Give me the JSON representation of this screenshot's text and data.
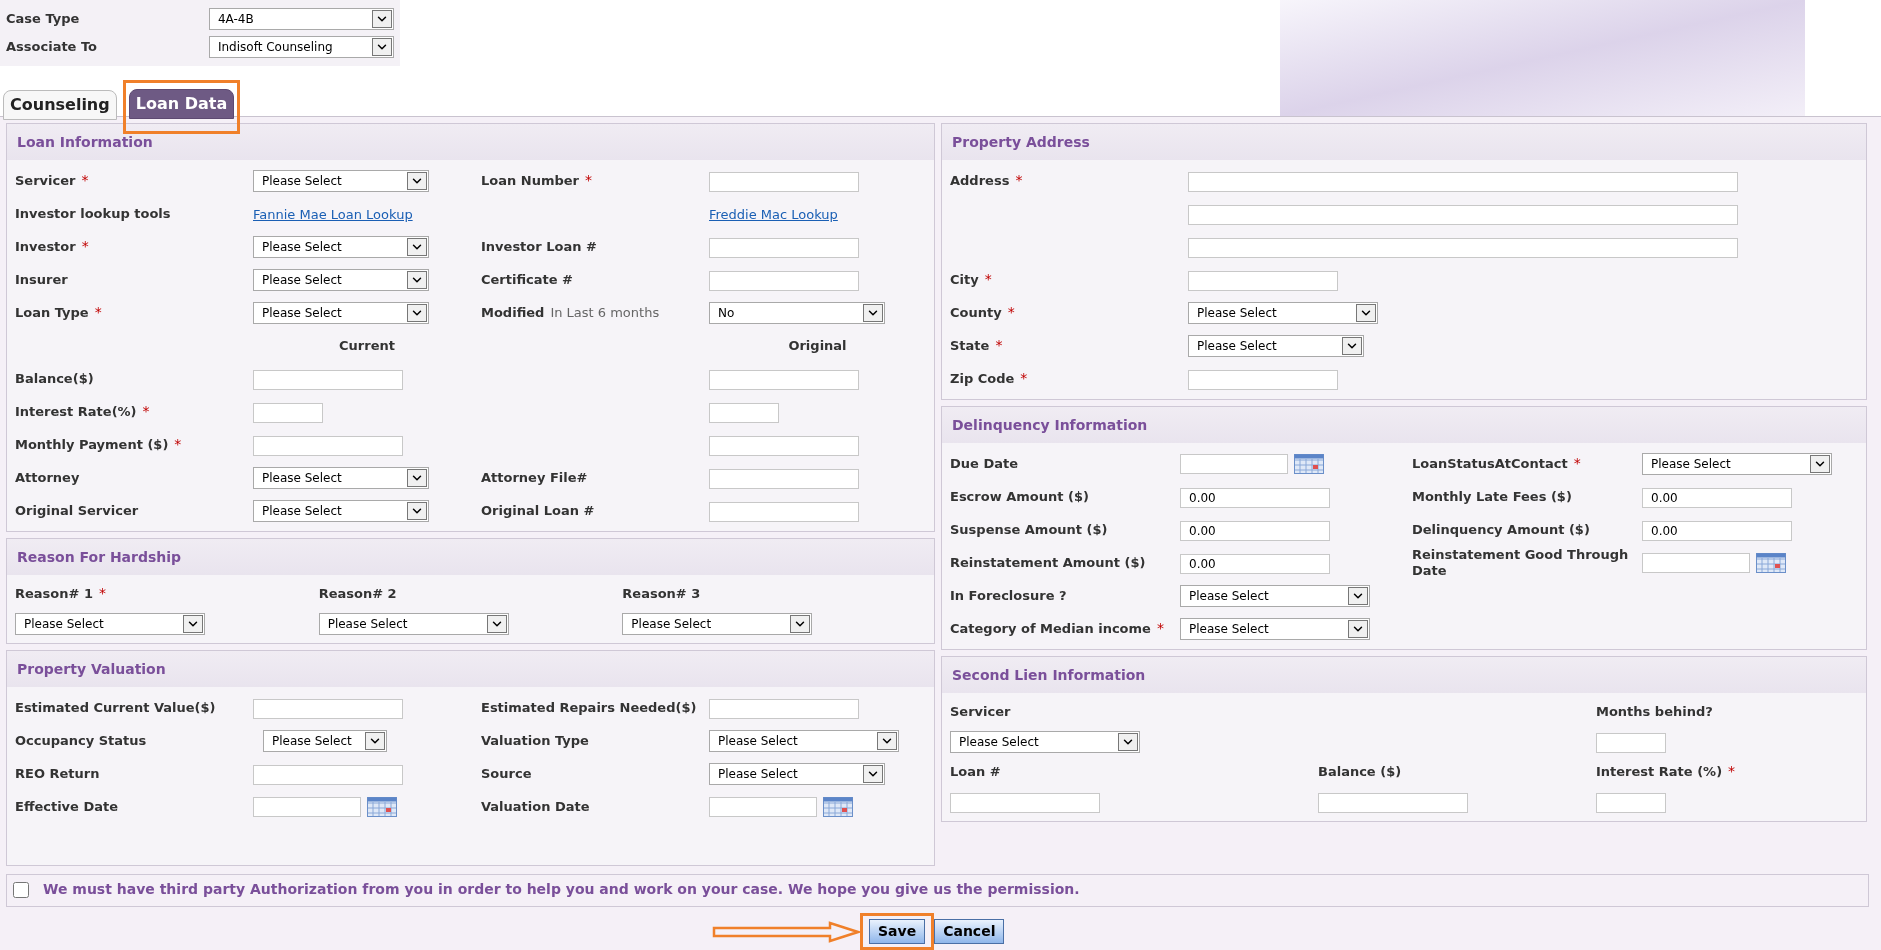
{
  "header": {
    "fields": [
      {
        "label": "Case Type",
        "value": "4A-4B"
      },
      {
        "label": "Associate To",
        "value": "Indisoft Counseling"
      }
    ],
    "tabs": [
      {
        "label": "Counseling",
        "selected": false,
        "highlighted": false
      },
      {
        "label": "Loan Data",
        "selected": true,
        "highlighted": true
      }
    ]
  },
  "left_column": [
    {
      "title": "Loan Information",
      "kind": "four_column",
      "rows": [
        {
          "cells": [
            {
              "kind": "label",
              "text": "Servicer",
              "mark": "*"
            },
            {
              "kind": "select",
              "value": "Please Select"
            },
            {
              "kind": "label",
              "text": "Loan Number",
              "mark": "*"
            },
            {
              "kind": "text"
            }
          ]
        },
        {
          "cells": [
            {
              "kind": "label",
              "text": "Investor lookup tools"
            },
            {
              "kind": "link",
              "text": "Fannie Mae Loan Lookup"
            },
            {
              "kind": "blank"
            },
            {
              "kind": "link",
              "text": "Freddie Mac Lookup"
            }
          ]
        },
        {
          "cells": [
            {
              "kind": "label",
              "text": "Investor",
              "mark": "*"
            },
            {
              "kind": "select",
              "value": "Please Select"
            },
            {
              "kind": "label",
              "text": "Investor Loan #"
            },
            {
              "kind": "text"
            }
          ]
        },
        {
          "cells": [
            {
              "kind": "label",
              "text": "Insurer"
            },
            {
              "kind": "select",
              "value": "Please Select"
            },
            {
              "kind": "label",
              "text": "Certificate #"
            },
            {
              "kind": "text"
            }
          ]
        },
        {
          "cells": [
            {
              "kind": "label",
              "text": "Loan Type",
              "mark": "*"
            },
            {
              "kind": "select",
              "value": "Please Select"
            },
            {
              "kind": "label",
              "text": "Modified",
              "note": "In Last 6 months"
            },
            {
              "kind": "select",
              "value": "No"
            }
          ]
        },
        {
          "cells": [
            {
              "kind": "blank"
            },
            {
              "kind": "heading",
              "text": "Current"
            },
            {
              "kind": "blank"
            },
            {
              "kind": "heading",
              "text": "Original"
            }
          ]
        },
        {
          "cells": [
            {
              "kind": "label",
              "text": "Balance($)"
            },
            {
              "kind": "text"
            },
            {
              "kind": "blank"
            },
            {
              "kind": "text"
            }
          ]
        },
        {
          "cells": [
            {
              "kind": "label",
              "text": "Interest Rate(%)",
              "mark": "*"
            },
            {
              "kind": "short"
            },
            {
              "kind": "blank"
            },
            {
              "kind": "short"
            }
          ]
        },
        {
          "cells": [
            {
              "kind": "label",
              "text": "Monthly Payment ($)",
              "mark": "*"
            },
            {
              "kind": "text"
            },
            {
              "kind": "blank"
            },
            {
              "kind": "text"
            }
          ]
        },
        {
          "cells": [
            {
              "kind": "label",
              "text": "Attorney"
            },
            {
              "kind": "select",
              "value": "Please Select"
            },
            {
              "kind": "label",
              "text": "Attorney File#"
            },
            {
              "kind": "text"
            }
          ]
        },
        {
          "cells": [
            {
              "kind": "label",
              "text": "Original Servicer"
            },
            {
              "kind": "select",
              "value": "Please Select"
            },
            {
              "kind": "label",
              "text": "Original Loan #"
            },
            {
              "kind": "text"
            }
          ]
        }
      ]
    },
    {
      "title": "Reason For Hardship",
      "kind": "three_column",
      "rows": [
        {
          "cells": [
            {
              "kind": "label",
              "text": "Reason# 1",
              "mark": "*"
            },
            {
              "kind": "label",
              "text": "Reason# 2"
            },
            {
              "kind": "label",
              "text": "Reason# 3"
            }
          ]
        },
        {
          "cells": [
            {
              "kind": "select_wide",
              "value": "Please Select"
            },
            {
              "kind": "select_wide",
              "value": "Please Select"
            },
            {
              "kind": "select_wide",
              "value": "Please Select"
            }
          ]
        }
      ]
    },
    {
      "title": "Property Valuation",
      "kind": "four_column",
      "rows": [
        {
          "cells": [
            {
              "kind": "label",
              "text": "Estimated Current Value($)"
            },
            {
              "kind": "text"
            },
            {
              "kind": "label",
              "text": "Estimated Repairs Needed($)"
            },
            {
              "kind": "text"
            }
          ]
        },
        {
          "cells": [
            {
              "kind": "label",
              "text": "Occupancy Status"
            },
            {
              "kind": "select_narrow",
              "value": "Please Select"
            },
            {
              "kind": "label",
              "text": "Valuation Type"
            },
            {
              "kind": "select_wide",
              "value": "Please Select"
            }
          ]
        },
        {
          "cells": [
            {
              "kind": "label",
              "text": "REO Return"
            },
            {
              "kind": "text"
            },
            {
              "kind": "label",
              "text": "Source"
            },
            {
              "kind": "select",
              "value": "Please Select"
            }
          ]
        },
        {
          "cells": [
            {
              "kind": "label",
              "text": "Effective Date"
            },
            {
              "kind": "date"
            },
            {
              "kind": "label",
              "text": "Valuation Date"
            },
            {
              "kind": "date"
            }
          ]
        }
      ]
    }
  ],
  "right_column": [
    {
      "title": "Property Address",
      "kind": "two_column",
      "rows": [
        {
          "cells": [
            {
              "kind": "label",
              "text": "Address",
              "mark": "*"
            },
            {
              "kind": "wide"
            }
          ]
        },
        {
          "cells": [
            {
              "kind": "blank"
            },
            {
              "kind": "wide"
            }
          ]
        },
        {
          "cells": [
            {
              "kind": "blank"
            },
            {
              "kind": "wide"
            }
          ]
        },
        {
          "cells": [
            {
              "kind": "label",
              "text": "City",
              "mark": "*"
            },
            {
              "kind": "text"
            }
          ]
        },
        {
          "cells": [
            {
              "kind": "label",
              "text": "County",
              "mark": "*"
            },
            {
              "kind": "select_wide",
              "value": "Please Select"
            }
          ]
        },
        {
          "cells": [
            {
              "kind": "label",
              "text": "State",
              "mark": "*"
            },
            {
              "kind": "select",
              "value": "Please Select"
            }
          ]
        },
        {
          "cells": [
            {
              "kind": "label",
              "text": "Zip Code",
              "mark": "*"
            },
            {
              "kind": "text"
            }
          ]
        }
      ]
    },
    {
      "title": "Delinquency Information",
      "kind": "four_column",
      "rows": [
        {
          "cells": [
            {
              "kind": "label",
              "text": "Due Date"
            },
            {
              "kind": "date"
            },
            {
              "kind": "label",
              "text": "LoanStatusAtContact",
              "mark": "*"
            },
            {
              "kind": "select_wide",
              "value": "Please Select"
            }
          ]
        },
        {
          "cells": [
            {
              "kind": "label",
              "text": "Escrow Amount ($)"
            },
            {
              "kind": "text",
              "value": "0.00"
            },
            {
              "kind": "label",
              "text": "Monthly Late Fees ($)"
            },
            {
              "kind": "text",
              "value": "0.00"
            }
          ]
        },
        {
          "cells": [
            {
              "kind": "label",
              "text": "Suspense Amount ($)"
            },
            {
              "kind": "text",
              "value": "0.00"
            },
            {
              "kind": "label",
              "text": "Delinquency Amount ($)"
            },
            {
              "kind": "text",
              "value": "0.00"
            }
          ]
        },
        {
          "cells": [
            {
              "kind": "label",
              "text": "Reinstatement Amount ($)"
            },
            {
              "kind": "text",
              "value": "0.00"
            },
            {
              "kind": "label",
              "text": "Reinstatement Good Through Date"
            },
            {
              "kind": "date"
            }
          ]
        },
        {
          "cells": [
            {
              "kind": "label",
              "text": "In Foreclosure ?"
            },
            {
              "kind": "select_wide",
              "value": "Please Select"
            },
            {
              "kind": "blank"
            },
            {
              "kind": "blank"
            }
          ]
        },
        {
          "cells": [
            {
              "kind": "label",
              "text": "Category of Median income",
              "mark": "*"
            },
            {
              "kind": "select_wide",
              "value": "Please Select"
            },
            {
              "kind": "blank"
            },
            {
              "kind": "blank"
            }
          ]
        }
      ]
    },
    {
      "title": "Second Lien Information",
      "kind": "three_column",
      "rows": [
        {
          "cells": [
            {
              "kind": "label",
              "text": "Servicer"
            },
            {
              "kind": "blank"
            },
            {
              "kind": "label",
              "text": "Months behind?"
            }
          ]
        },
        {
          "cells": [
            {
              "kind": "select_wide",
              "value": "Please Select"
            },
            {
              "kind": "blank"
            },
            {
              "kind": "short"
            }
          ]
        },
        {
          "cells": [
            {
              "kind": "label",
              "text": "Loan #"
            },
            {
              "kind": "label",
              "text": "Balance ($)"
            },
            {
              "kind": "label",
              "text": "Interest Rate (%)",
              "mark": "*"
            }
          ]
        },
        {
          "cells": [
            {
              "kind": "text"
            },
            {
              "kind": "text"
            },
            {
              "kind": "short"
            }
          ]
        }
      ]
    }
  ],
  "authorization": {
    "checked": false,
    "text": "We must have third party Authorization from you in order to help you and work on your case. We hope you give us the permission."
  },
  "buttons": [
    {
      "label": "Save",
      "highlighted": true
    },
    {
      "label": "Cancel",
      "highlighted": false
    }
  ]
}
